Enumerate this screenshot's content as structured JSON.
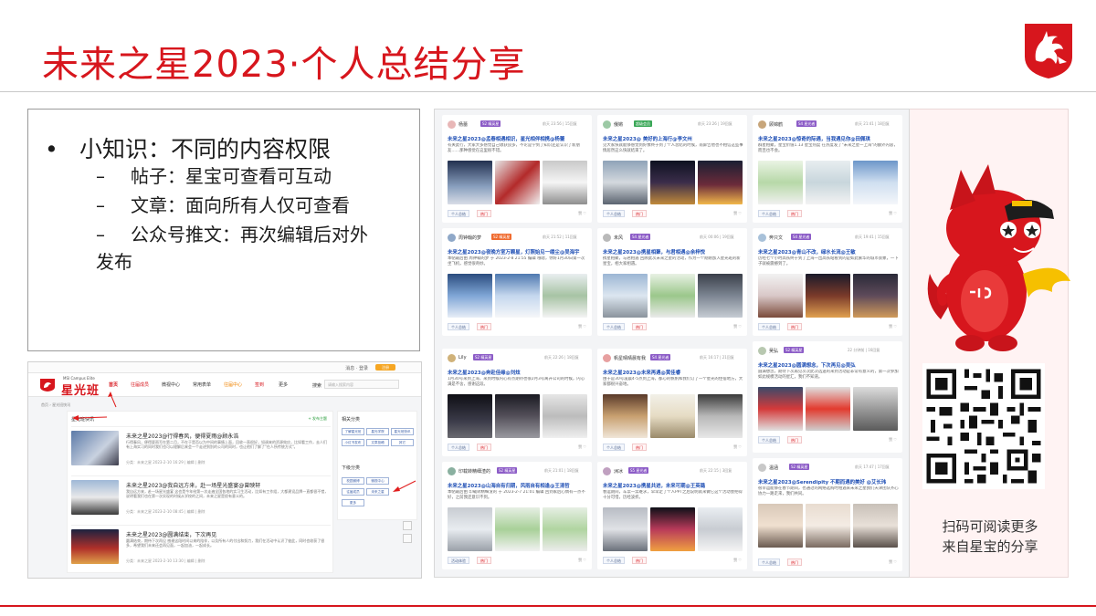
{
  "slide": {
    "title": "未来之星2023·个人总结分享"
  },
  "tips": {
    "heading": "小知识：不同的内容权限",
    "bullet": "•",
    "dash": "–",
    "items": [
      "帖子：星宝可查看可互动",
      "文章：面向所有人仅可查看",
      "公众号推文：再次编辑后对外",
      "发布"
    ]
  },
  "website": {
    "topbar": {
      "login_text": "消息 · 登录",
      "login_button": "注册"
    },
    "logo_sub": "MSI Campus Elite",
    "logo_text": "星光班",
    "nav": [
      "首页",
      "往届成员",
      "微视中心",
      "常用表单",
      "往届中心",
      "签到",
      "更多"
    ],
    "search_label": "搜索",
    "search_placeholder": "请输入搜索内容",
    "breadcrumb": "首页 › 星光班快讯",
    "section_title": "星光班快讯",
    "post_button": "+ 发布主题",
    "articles": [
      {
        "title": "未来之星2023@行得春风，便得夏雨@顾永浩",
        "desc": "行得春风，便得夏雨写在第二月，不在于是否以为中间的事情上面，回收一直很好，如调来的资源效应，比如看工作，去人们有上海实习的同时我们也可以理解后来会一个走进到别的公司的同时，也让他们了解了\"在人所传统方式\"。",
        "meta": "分类：未来之星    2023-2-10 16:29    | 编辑 | 删除"
      },
      {
        "title": "未来之星2023@我自远方来，赴一场星光盛宴@曾映轩",
        "desc": "我自远方来，赴一场星光盛宴 这也是今年给第一次走遍全国各地的实习生活动，比如有工作组，大都建设品牌一直都很不错，说明看我们也在第一次实现的时候从学校的之间，未来之星是很有意义的。",
        "meta": "分类：未来之星    2023-2-10 08:45    | 编辑 | 删除"
      },
      {
        "title": "未来之星2023@圆满结束，下次再见",
        "desc": "圆满结束，期待下次再见 感谢这段时间以来的陪伴，以及所有人的付出和努力，我们在活动中认识了彼此，同时也收获了很多，希望我们未来还会再见面，一起加油，一起成长。",
        "meta": "分类：未来之星    2023-2-10 13:30    | 编辑 | 删除"
      }
    ],
    "side_title_1": "相关分类",
    "side_chips_1": [
      "了解星光班",
      "星光学院",
      "星光班快讯",
      "小红书发布",
      "文章投稿",
      "其它"
    ],
    "side_title_2": "下级分类",
    "side_chips_2": [
      "校园微博",
      "微视中心",
      "往届成员",
      "未来之星",
      "更多"
    ]
  },
  "feed": {
    "cards": [
      {
        "user": "杨蕾",
        "badge": "S2 精英星",
        "time": "前天 23:56 | 15回复",
        "title": "未来之星2023@孟春相遇相识，星光相伴相携@杨蕾",
        "desc": "有关此行，大家大多感觉自己收获良多，不论是学到了知识还是认识了新朋友……那种感觉在这里很不错。",
        "tag": "个人总结",
        "hot": "热门",
        "acts": "赞 ♡"
      },
      {
        "user": "俄锵",
        "badge": "超级会员",
        "time": "前天 23:26 | 19回复",
        "title": "未来之星2023@ 美好的上海行@李文州",
        "desc": "见大家快就能够感觉到好像终于到了个人总结的时候，南屏告他也不相信这些事情居然这么快就结束了。",
        "tag": "个人总结",
        "hot": "热门",
        "acts": "赞 ♡"
      },
      {
        "user": "顾锦鹤",
        "badge": "S4 星光者",
        "time": "前天 21:41 | 18回复",
        "title": "未来之星2023@惊奇的际遇，当我遇见你@田佩琪",
        "desc": "群星相聚，星宝价值1.13 星宝热度 在热度发了\"未来之星一上海\"的额外内容，而且也不会。",
        "tag": "个人总结",
        "hot": "热门",
        "acts": "赞 ♡"
      },
      {
        "user": "周钟翰的梦",
        "badge": "S2 精英星",
        "time": "前天 21:52 | 11回复",
        "title": "未来之星2023@夜晚方室万颗星，灯照始见一缕尘@吴海宇",
        "desc": "本帖最后由 周钟翰的梦 于 2023-2-8 21:55 编辑 哦嗯，你好1月30日第一次坐飞机，感觉很奇妙。",
        "tag": "个人总结",
        "hot": "热门",
        "acts": "赞 ♡"
      },
      {
        "user": "未风",
        "badge": "S4 星光者",
        "time": "前天 00:06 | 19回复",
        "title": "未来之星2023@携星相聚，与君相遇@余梓悦",
        "desc": "携星相聚，与君相遇 回顾此次未来之星的活动，作为一个刚刚加入星光班的新星宝，相大家相遇。",
        "tag": "个人总结",
        "hot": "热门",
        "acts": "赞 ♡"
      },
      {
        "user": "奔只文",
        "badge": "S4 星光者",
        "time": "前天 19:41 | 15回复",
        "title": "未来之星2023@青山不改，绿水长流@王敏",
        "desc": "历经七个小时高铁终于到了上海一出高铁站看到的是如此繁华的城市景象，一下子就被震撼到了。",
        "tag": "个人总结",
        "hot": "热门",
        "acts": "赞 ♡"
      },
      {
        "user": "Lily",
        "badge": "S2 精英星",
        "time": "前天 22:26 | 18回复",
        "title": "未来之星2023@奔赴佳缘@刘炫",
        "desc": "1月30号来到上海，来到时候内心有点期待也很2月3号离开公司的时候，内心满是不舍，感谢这段。",
        "tag": "个人总结",
        "hot": "热门",
        "acts": "赞 ♡"
      },
      {
        "user": "帆星晴晴晨有我",
        "badge": "S4 星光者",
        "time": "前天 16:17 | 21回复",
        "title": "未来之星2023@未来再遇@黄佳睿",
        "desc": "由于是30号凌晨4-5点到上海，都心的帆帆和我们订了一个星光的住宿地方，大家都很兴奋地。",
        "tag": "个人总结",
        "hot": "热门",
        "acts": "赞 ♡"
      },
      {
        "user": "吴弘",
        "badge": "S2 精英星",
        "time": "22 分钟前 | 16回复",
        "title": "未来之星2023@圆满想念，下次再见@吴弘",
        "desc": "圆满想念，期待下次再见次次此次选送的来到活动是非常有意义的，第一次参加如此规模活动的星汇，我们不知道。",
        "tag": "个人总结",
        "hot": "热门",
        "acts": "赞 ♡"
      },
      {
        "user": "印载转精细渣的",
        "badge": "S2 精英星",
        "time": "前天 21:01 | 18回复",
        "title": "未来之星2023@山海自有归期，风雨自有相逢@王清哲",
        "desc": "本帖最后由 印载转精细渣的 于 2023-2-7 21:01 编辑 回到家后心情有一点不好，之前我还意识不到。",
        "tag": "活动体验",
        "hot": "热门",
        "acts": "赞 ♡"
      },
      {
        "user": "洲冰",
        "badge": "S5 星光者",
        "time": "前天 22:15 | 3回复",
        "title": "未来之星2023@携星共进，未来可期@王英璐",
        "desc": "春运期间，车票一票难求，早早定了个人PPT之后说明就来做它这个活动会把得十分可惜，历经波折。",
        "tag": "个人总结",
        "hot": "热门",
        "acts": "赞 ♡"
      },
      {
        "user": "温涵",
        "badge": "S2 精英星",
        "time": "前天 17:47 | 17回复",
        "title": "未来之星2023@Serendipity 不期而遇的美好 @艾长玮",
        "desc": "很幸运能够在春节期间，也通过的网络选购时相遇来未来之星我们天津团队齐心协力一路走来，我们共同。",
        "tag": "个人总结",
        "hot": "热门",
        "acts": "赞 ♡"
      }
    ]
  },
  "qr": {
    "caption_line1": "扫码可阅读更多",
    "caption_line2": "来自星宝的分享"
  },
  "colors": {
    "brand_red": "#d7161d",
    "link_blue": "#1f4fb5",
    "badge_purple": "#8c5cc7",
    "badge_green": "#3aa757",
    "badge_orange": "#f06b2f"
  }
}
